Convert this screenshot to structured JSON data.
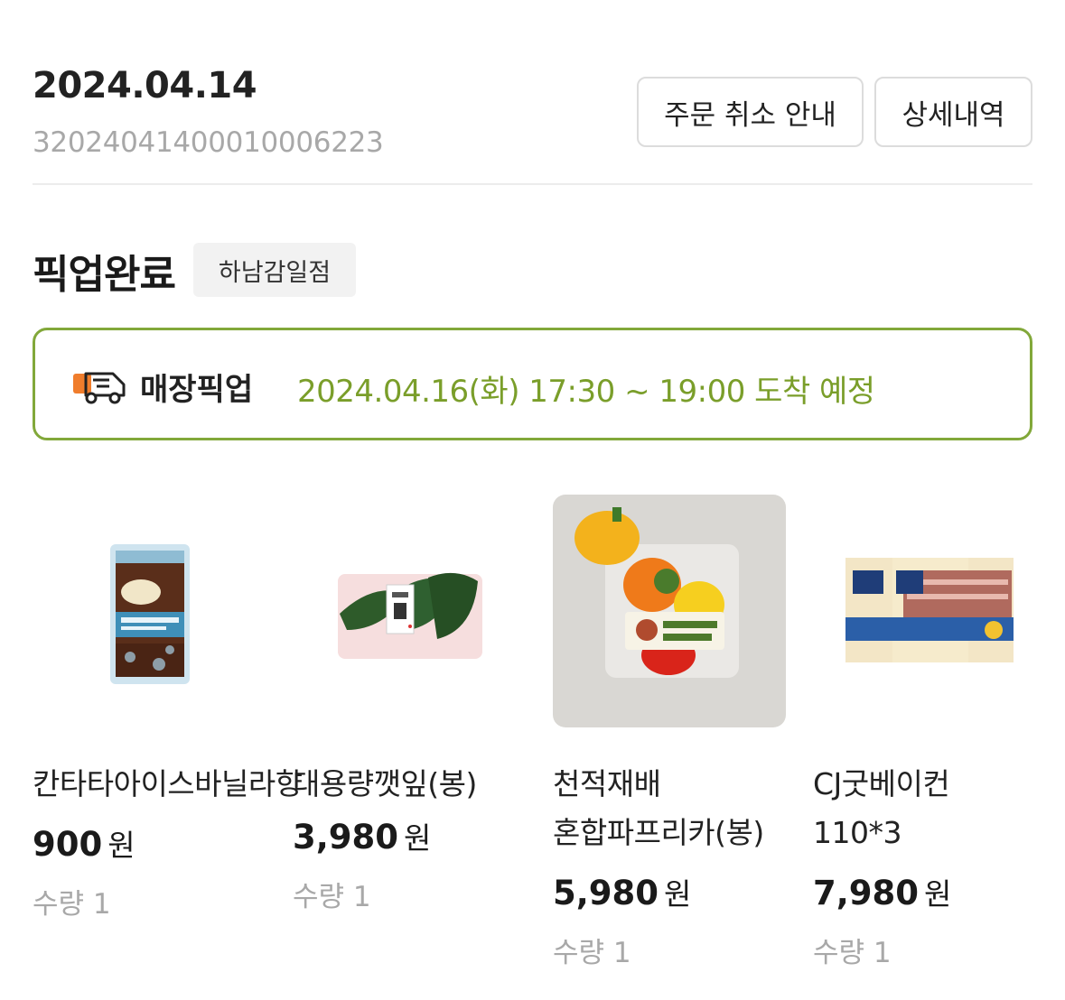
{
  "order": {
    "date": "2024.04.14",
    "number": "320240414000100062 23",
    "cancel_button": "주문 취소 안내",
    "detail_button": "상세내역"
  },
  "status": {
    "title": "픽업완료",
    "store": "하남감일점"
  },
  "pickup": {
    "icon": "delivery-truck-icon",
    "label": "매장픽업",
    "time": "2024.04.16(화) 17:30 ~ 19:00 도착 예정",
    "accent_color": "#82a83a",
    "time_color": "#7a9e2a"
  },
  "products": [
    {
      "name": "칸타타아이스바닐라향",
      "price": "900",
      "currency": "원",
      "qty": "수량 1",
      "image": "coffee-pouch-image"
    },
    {
      "name": "대용량깻잎(봉)",
      "price": "3,980",
      "currency": "원",
      "qty": "수량 1",
      "image": "perilla-leaves-image"
    },
    {
      "name": "천적재배 혼합파프리카(봉)",
      "price": "5,980",
      "currency": "원",
      "qty": "수량 1",
      "image": "paprika-bag-image"
    },
    {
      "name": "CJ굿베이컨 110*3",
      "price": "7,980",
      "currency": "원",
      "qty": "수량 1",
      "image": "bacon-pack-image"
    }
  ]
}
